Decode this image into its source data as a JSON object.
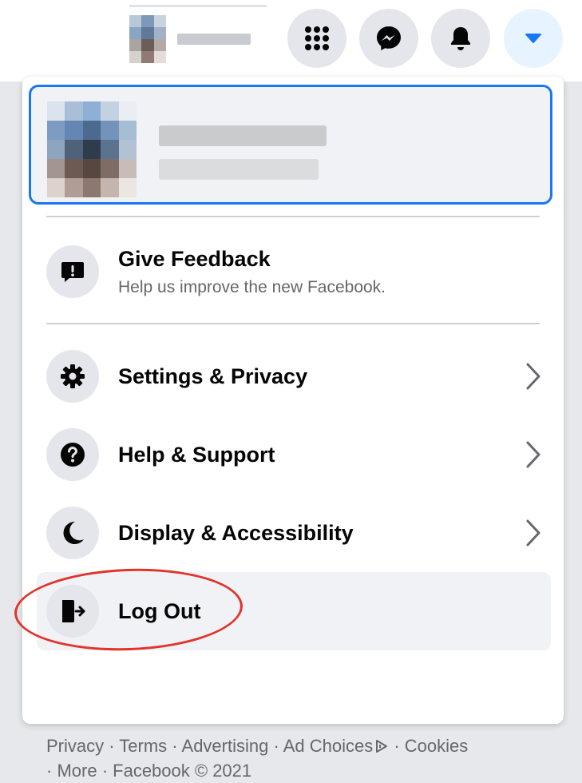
{
  "colors": {
    "accent": "#1877f2",
    "highlight_ring": "#e0342c",
    "icon_bg": "#e4e6eb",
    "hover_bg": "#f0f2f5",
    "secondary_text": "#65676b"
  },
  "topbar": {
    "buttons": [
      {
        "name": "menu-grid",
        "icon": "grid-dots-icon"
      },
      {
        "name": "messenger",
        "icon": "messenger-icon"
      },
      {
        "name": "notifications",
        "icon": "bell-icon"
      },
      {
        "name": "account",
        "icon": "caret-down-icon",
        "active": true
      }
    ]
  },
  "menu": {
    "feedback": {
      "label": "Give Feedback",
      "sub": "Help us improve the new Facebook.",
      "icon": "feedback-exclamation-icon"
    },
    "items": [
      {
        "label": "Settings & Privacy",
        "icon": "gear-icon",
        "has_arrow": true
      },
      {
        "label": "Help & Support",
        "icon": "question-icon",
        "has_arrow": true
      },
      {
        "label": "Display & Accessibility",
        "icon": "moon-icon",
        "has_arrow": true
      },
      {
        "label": "Log Out",
        "icon": "logout-door-icon",
        "has_arrow": false
      }
    ],
    "footer": {
      "links": [
        "Privacy",
        "Terms",
        "Advertising",
        "Ad Choices",
        "Cookies",
        "More"
      ],
      "separator": " · ",
      "copyright": "Facebook © 2021"
    }
  }
}
